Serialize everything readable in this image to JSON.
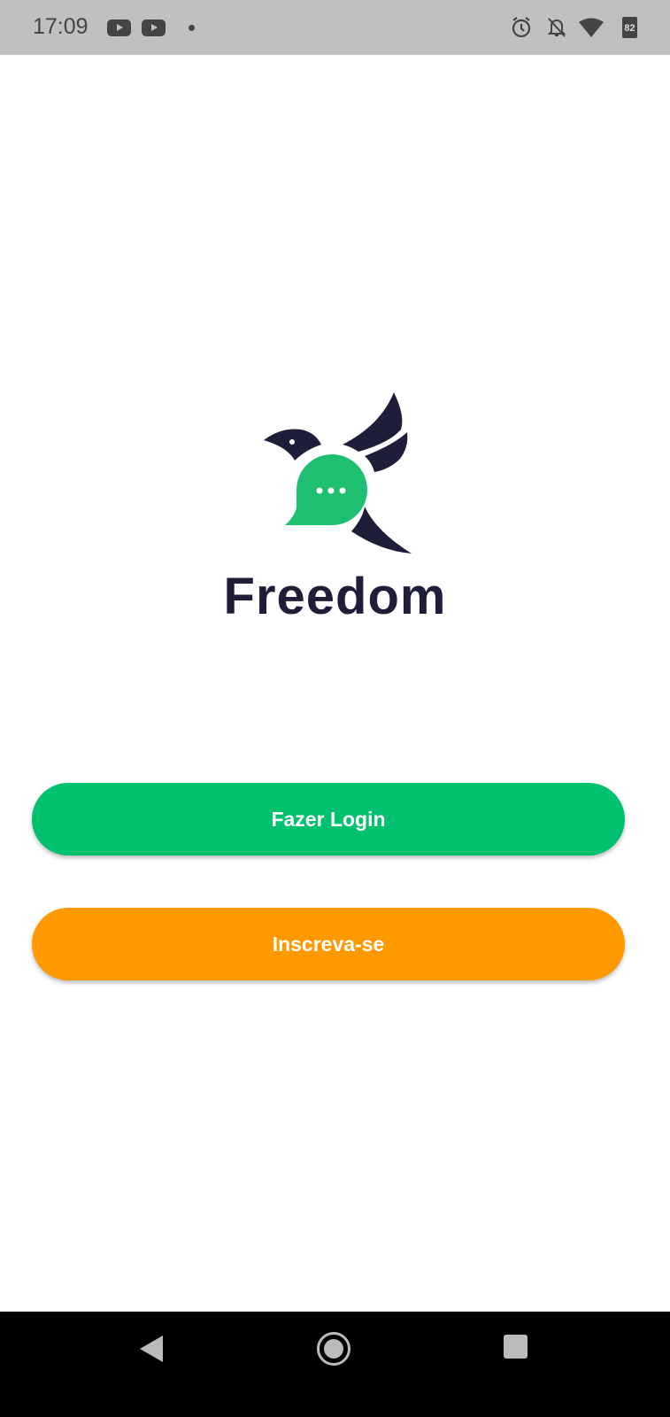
{
  "status_bar": {
    "time": "17:09",
    "battery": "82",
    "icons": [
      "youtube-icon",
      "youtube-icon",
      "notification-dot",
      "alarm-icon",
      "notifications-off-icon",
      "wifi-icon",
      "battery-icon"
    ]
  },
  "app": {
    "name": "Freedom",
    "colors": {
      "primary": "#00c16e",
      "secondary": "#ff9900",
      "dark": "#1f1e3a"
    }
  },
  "actions": {
    "login_label": "Fazer Login",
    "signup_label": "Inscreva-se"
  },
  "nav_bar": {
    "icons": [
      "back-icon",
      "home-icon",
      "recents-icon"
    ]
  }
}
